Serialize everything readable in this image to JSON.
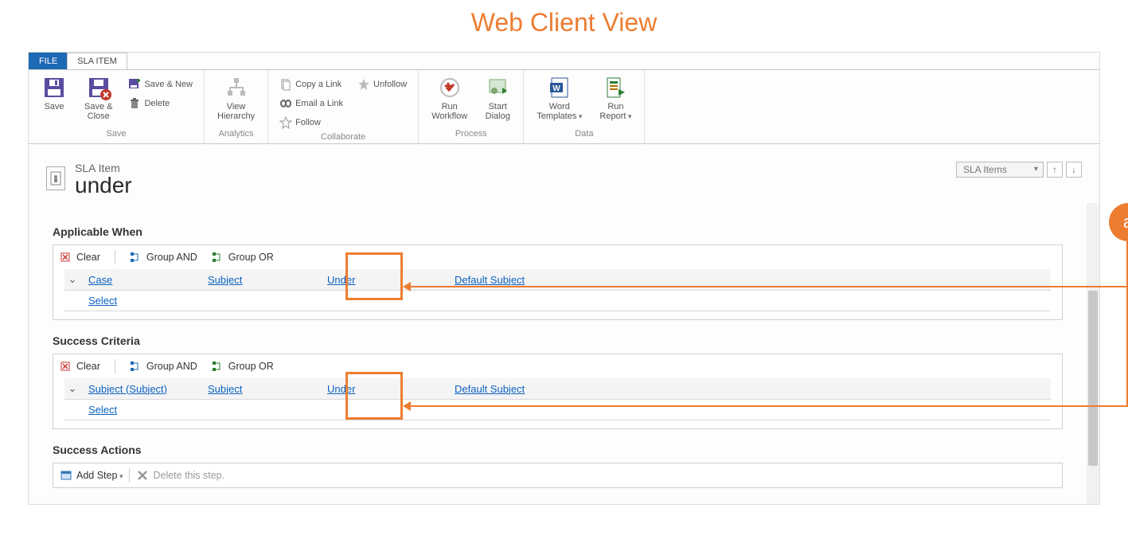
{
  "banner_title": "Web Client View",
  "tabs": {
    "file": "FILE",
    "sla_item": "SLA ITEM"
  },
  "ribbon": {
    "save_group": {
      "title": "Save",
      "save": "Save",
      "save_close": "Save &\nClose",
      "save_new": "Save & New",
      "delete": "Delete"
    },
    "analytics_group": {
      "title": "Analytics",
      "view_hierarchy": "View\nHierarchy"
    },
    "collaborate_group": {
      "title": "Collaborate",
      "copy_link": "Copy a Link",
      "email_link": "Email a Link",
      "follow": "Follow",
      "unfollow": "Unfollow"
    },
    "process_group": {
      "title": "Process",
      "run_workflow": "Run\nWorkflow",
      "start_dialog": "Start\nDialog"
    },
    "data_group": {
      "title": "Data",
      "word_templates": "Word\nTemplates",
      "run_report": "Run\nReport"
    }
  },
  "header": {
    "entity_type": "SLA Item",
    "record_name": "under",
    "picker_selected": "SLA Items"
  },
  "sections": {
    "applicable_when": {
      "heading": "Applicable When",
      "toolbar": {
        "clear": "Clear",
        "group_and": "Group AND",
        "group_or": "Group OR"
      },
      "row": {
        "entity": "Case",
        "attribute": "Subject",
        "operator": "Under",
        "value": "Default Subject"
      },
      "select": "Select"
    },
    "success_criteria": {
      "heading": "Success Criteria",
      "toolbar": {
        "clear": "Clear",
        "group_and": "Group AND",
        "group_or": "Group OR"
      },
      "row": {
        "entity": "Subject (Subject)",
        "attribute": "Subject",
        "operator": "Under",
        "value": "Default Subject"
      },
      "select": "Select"
    },
    "success_actions": {
      "heading": "Success Actions",
      "add_step": "Add Step",
      "delete_step": "Delete this step."
    }
  },
  "annotation": {
    "label": "a"
  }
}
